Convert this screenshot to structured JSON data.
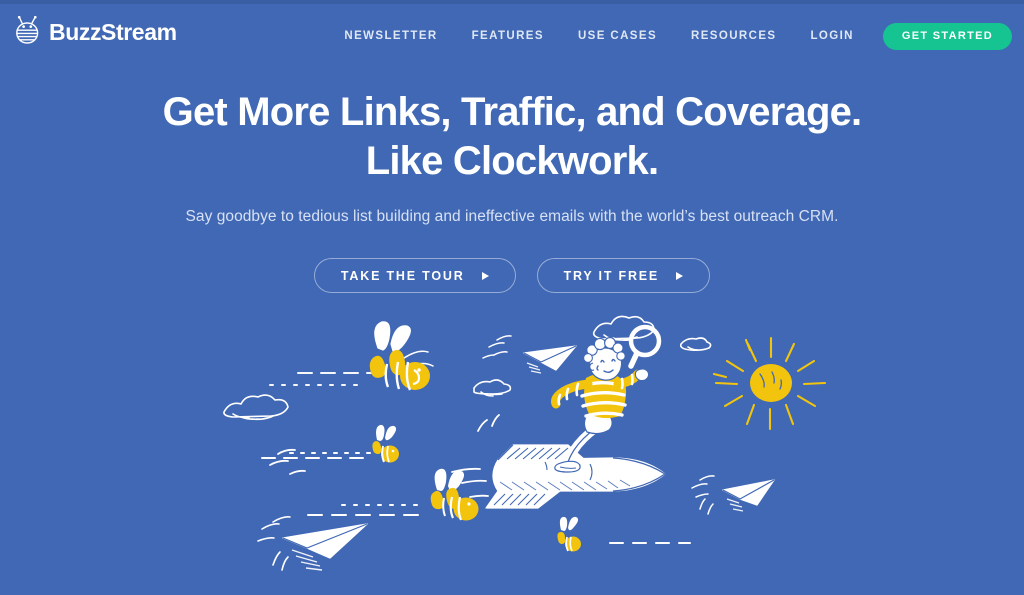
{
  "site": {
    "brand_name": "BuzzStream",
    "logo_icon": "bee-icon",
    "background_color": "#4068b4",
    "accent_color": "#15c490",
    "illustration_yellow": "#f2c40d"
  },
  "header": {
    "nav_items": [
      {
        "label": "NEWSLETTER",
        "name": "nav-newsletter"
      },
      {
        "label": "FEATURES",
        "name": "nav-features"
      },
      {
        "label": "USE CASES",
        "name": "nav-use-cases"
      },
      {
        "label": "RESOURCES",
        "name": "nav-resources"
      },
      {
        "label": "LOGIN",
        "name": "nav-login"
      }
    ],
    "cta_label": "GET STARTED"
  },
  "hero": {
    "headline_line1": "Get More Links, Traffic, and Coverage.",
    "headline_line2": "Like Clockwork.",
    "subheadline": "Say goodbye to tedious list building and ineffective emails with the world’s best outreach CRM.",
    "buttons": [
      {
        "label": "TAKE THE TOUR",
        "icon": "play-triangle-icon"
      },
      {
        "label": "TRY IT FREE",
        "icon": "play-triangle-icon"
      }
    ]
  },
  "illustration": {
    "description": "Hand-drawn sketch scene on blue background",
    "elements": [
      "bee-large-left",
      "bee-small-middle",
      "bee-medium-lower",
      "bee-tiny-right",
      "paper-plane-upper",
      "paper-plane-lower-left",
      "paper-plane-right",
      "cloud-left",
      "cloud-upper",
      "cloud-small",
      "boy-on-rocket",
      "magnifying-glass",
      "sun"
    ]
  }
}
